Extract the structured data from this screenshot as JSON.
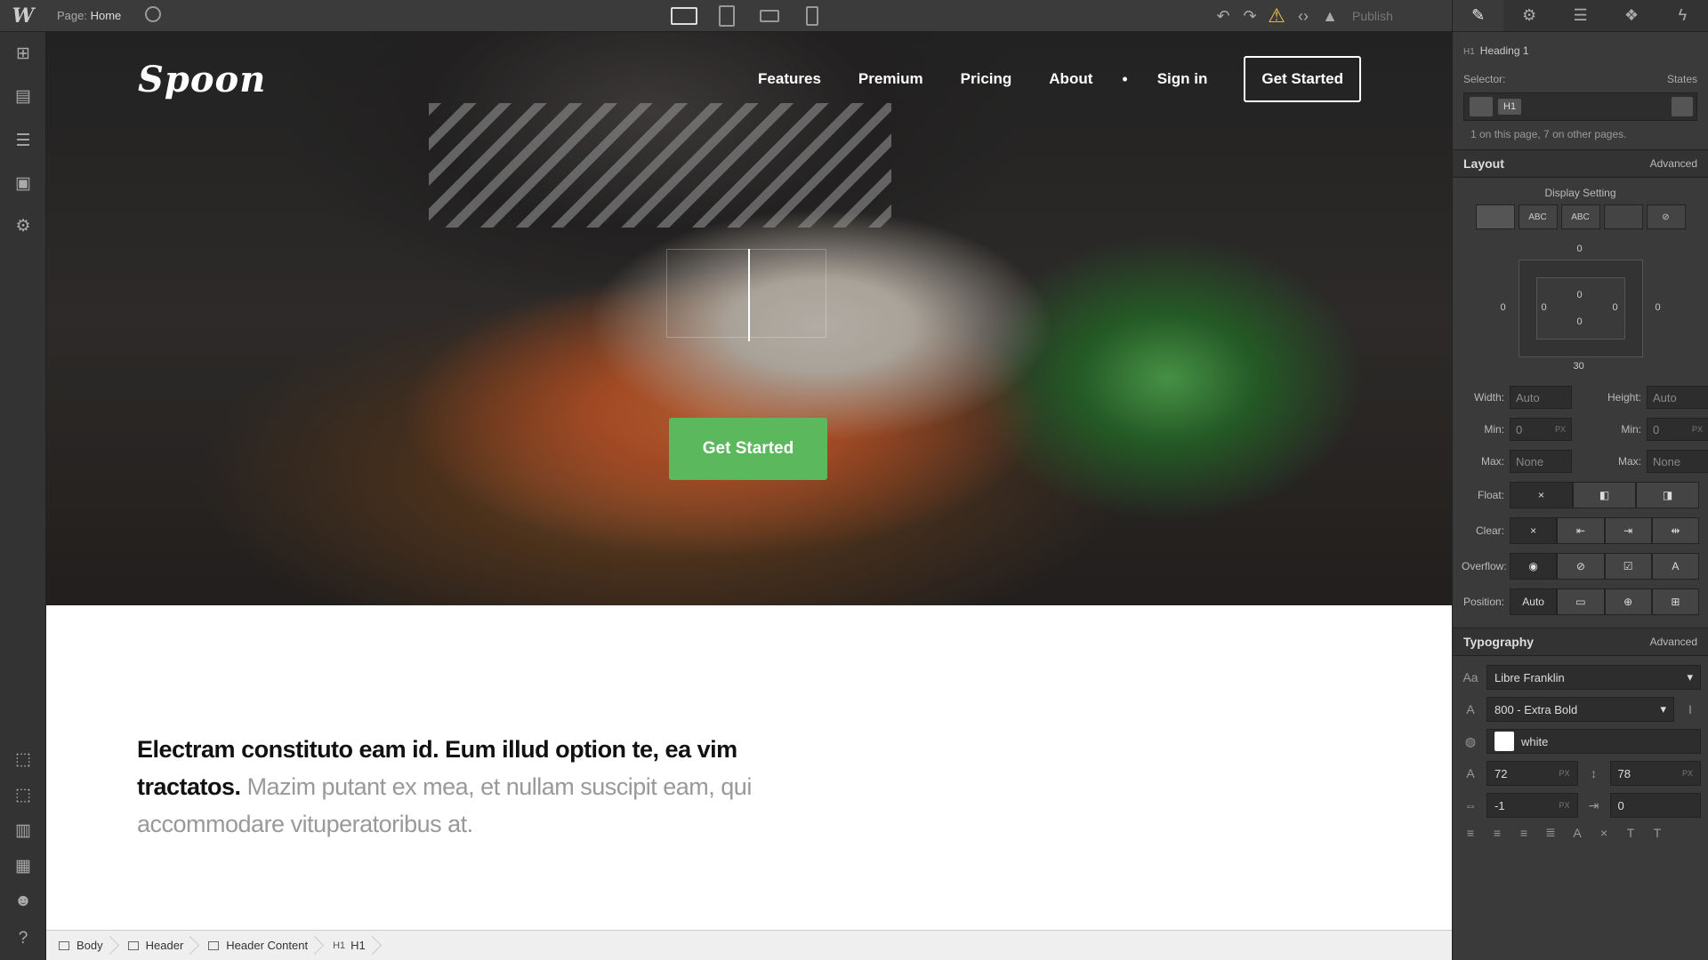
{
  "topbar": {
    "logo": "W",
    "page_prefix": "Page:",
    "page_name": "Home",
    "publish_label": "Publish"
  },
  "hero": {
    "brand": "Spoon",
    "nav": [
      "Features",
      "Premium",
      "Pricing",
      "About"
    ],
    "nav_dot": "•",
    "signin": "Sign in",
    "nav_cta": "Get Started",
    "cta": "Get Started"
  },
  "intro": {
    "strong": "Electram constituto eam id. Eum illud option te, ea vim tractatos.",
    "muted": "Mazim putant ex mea, et nullam suscipit eam, qui accommodare vituperatoribus at."
  },
  "breadcrumbs": [
    {
      "label": "Body",
      "prefix": ""
    },
    {
      "label": "Header",
      "prefix": ""
    },
    {
      "label": "Header Content",
      "prefix": ""
    },
    {
      "label": "H1",
      "prefix": "H1"
    }
  ],
  "panel": {
    "element_tag": "H1",
    "element_name": "Heading 1",
    "selector_label": "Selector:",
    "states_label": "States",
    "selector_tag": "H1",
    "selector_info": "1 on this page, 7 on other pages.",
    "layout": {
      "title": "Layout",
      "advanced": "Advanced",
      "display_label": "Display Setting",
      "display_buttons": [
        "",
        "ABC",
        "ABC",
        "",
        ""
      ],
      "margin_top": "0",
      "margin_left": "0",
      "margin_right": "0",
      "margin_bottom": "30",
      "padding_top": "0",
      "padding_left": "0",
      "padding_right": "0",
      "padding_bottom": "0",
      "width_label": "Width:",
      "width_value": "Auto",
      "height_label": "Height:",
      "height_value": "Auto",
      "min_label": "Min:",
      "min_w": "0",
      "min_h": "0",
      "unit_px": "PX",
      "max_label": "Max:",
      "max_w": "None",
      "max_h": "None",
      "float_label": "Float:",
      "clear_label": "Clear:",
      "overflow_label": "Overflow:",
      "position_label": "Position:",
      "position_value": "Auto",
      "none_glyph": "×"
    },
    "typography": {
      "title": "Typography",
      "advanced": "Advanced",
      "font": "Libre Franklin",
      "weight": "800 - Extra Bold",
      "color_name": "white",
      "color_hex": "#ffffff",
      "size": "72",
      "line_height": "78",
      "letter_spacing": "-1",
      "text_indent": "0",
      "unit_px": "PX"
    }
  },
  "colors": {
    "cta_green": "#5cb85c",
    "warning": "#f6c43c",
    "panel_bg": "#3a3a3a"
  }
}
